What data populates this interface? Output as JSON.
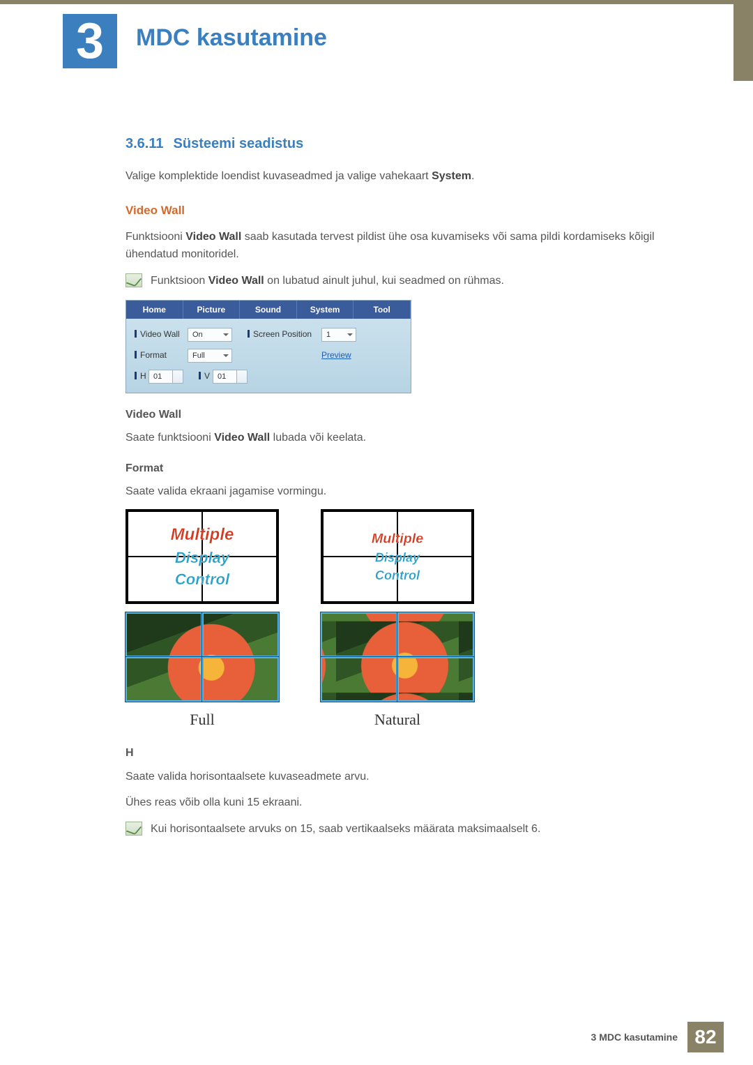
{
  "chapter": {
    "number": "3",
    "title": "MDC kasutamine"
  },
  "section": {
    "number": "3.6.11",
    "title": "Süsteemi seadistus"
  },
  "intro": {
    "text_prefix": "Valige komplektide loendist kuvaseadmed ja valige vahekaart ",
    "text_bold": "System",
    "text_suffix": "."
  },
  "video_wall_heading": "Video Wall",
  "video_wall_para": {
    "prefix": "Funktsiooni ",
    "bold": "Video Wall",
    "suffix": " saab kasutada tervest pildist ühe osa kuvamiseks või sama pildi kordamiseks kõigil ühendatud monitoridel."
  },
  "note1": {
    "prefix": "Funktsioon ",
    "bold": "Video Wall",
    "suffix": " on lubatud ainult juhul, kui seadmed on rühmas."
  },
  "mdc_panel": {
    "tabs": [
      "Home",
      "Picture",
      "Sound",
      "System",
      "Tool"
    ],
    "video_wall_label": "Video Wall",
    "video_wall_value": "On",
    "screen_pos_label": "Screen Position",
    "screen_pos_value": "1",
    "format_label": "Format",
    "format_value": "Full",
    "preview_label": "Preview",
    "h_label": "H",
    "h_value": "01",
    "v_label": "V",
    "v_value": "01"
  },
  "sub_video_wall": {
    "heading": "Video Wall",
    "text_prefix": "Saate funktsiooni ",
    "text_bold": "Video Wall",
    "text_suffix": " lubada või keelata."
  },
  "sub_format": {
    "heading": "Format",
    "text": "Saate valida ekraani jagamise vormingu."
  },
  "format_demo": {
    "overlay_line1": "Multiple",
    "overlay_line2": "Display",
    "overlay_line3": "Control",
    "caption_full": "Full",
    "caption_natural": "Natural"
  },
  "sub_h": {
    "heading": "H",
    "p1": "Saate valida horisontaalsete kuvaseadmete arvu.",
    "p2": "Ühes reas võib olla kuni 15 ekraani."
  },
  "note2": "Kui horisontaalsete arvuks on 15, saab vertikaalseks määrata maksimaalselt 6.",
  "footer": {
    "text": "3 MDC kasutamine",
    "page": "82"
  }
}
